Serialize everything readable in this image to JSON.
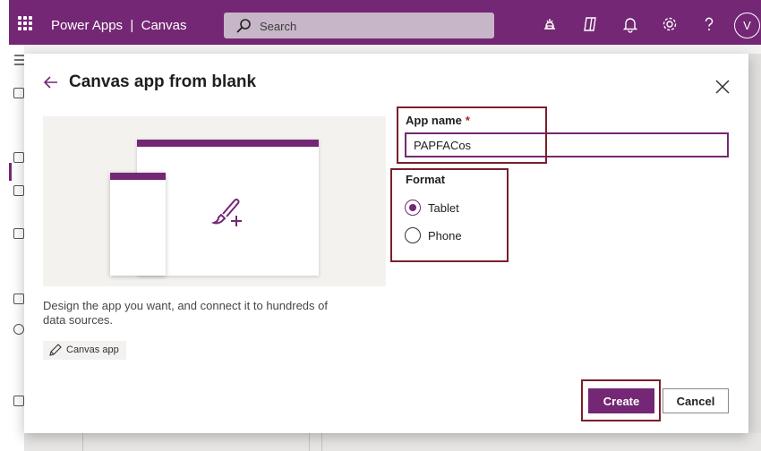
{
  "topbar": {
    "app_title": "Power Apps  |  Canvas",
    "search_placeholder": "Search",
    "avatar_initial": "V",
    "icons": [
      "waffle-icon",
      "search-icon",
      "environment-icon",
      "copilot-icon",
      "notifications-icon",
      "settings-icon",
      "help-icon"
    ],
    "brand_color": "#742774"
  },
  "dialog": {
    "title": "Canvas app from blank",
    "description": "Design the app you want, and connect it to hundreds of data sources.",
    "tag_label": "Canvas app",
    "app_name_label": "App name",
    "required_marker": "*",
    "app_name_value": "PAPFACos",
    "format_label": "Format",
    "format_options": [
      {
        "label": "Tablet",
        "selected": true
      },
      {
        "label": "Phone",
        "selected": false
      }
    ],
    "create_label": "Create",
    "cancel_label": "Cancel",
    "highlight_color": "#7a1f2b"
  }
}
